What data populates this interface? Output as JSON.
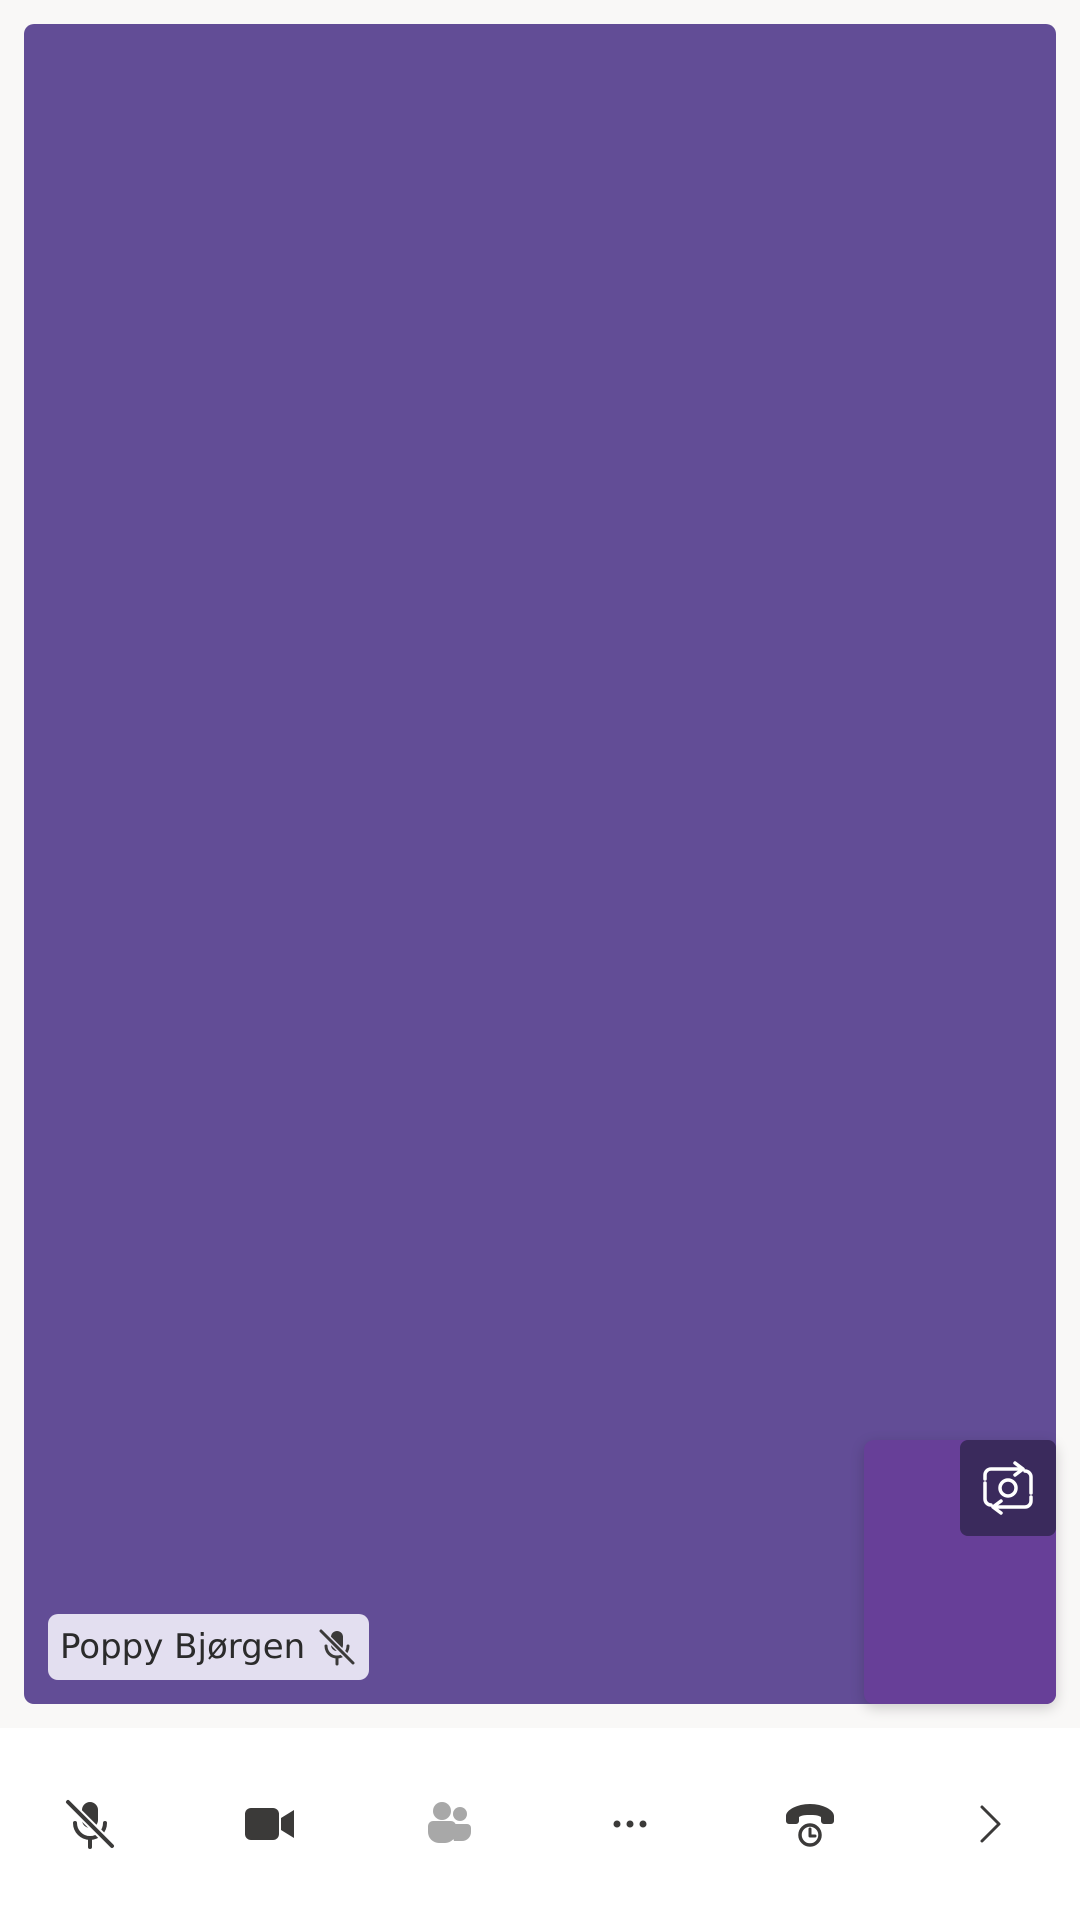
{
  "participant": {
    "name": "Poppy Bjørgen",
    "muted": true
  },
  "colors": {
    "stage_background": "#624d96",
    "self_tile_background": "#673f98",
    "toolbar_background": "#ffffff",
    "name_tag_background": "#e3dff0",
    "icon_dark": "#3b3a39",
    "icon_disabled": "#a8a8a8"
  },
  "toolbar": {
    "buttons": [
      {
        "id": "microphone",
        "icon": "microphone-off-icon",
        "state": "muted"
      },
      {
        "id": "camera",
        "icon": "video-camera-icon",
        "state": "on"
      },
      {
        "id": "participants",
        "icon": "people-icon",
        "state": "disabled"
      },
      {
        "id": "more",
        "icon": "more-options-icon",
        "state": "enabled"
      },
      {
        "id": "hang-up",
        "icon": "phone-clock-icon",
        "state": "enabled"
      },
      {
        "id": "expand",
        "icon": "chevron-right-icon",
        "state": "enabled"
      }
    ]
  },
  "self_view": {
    "switch_camera_icon": "switch-camera-icon"
  }
}
